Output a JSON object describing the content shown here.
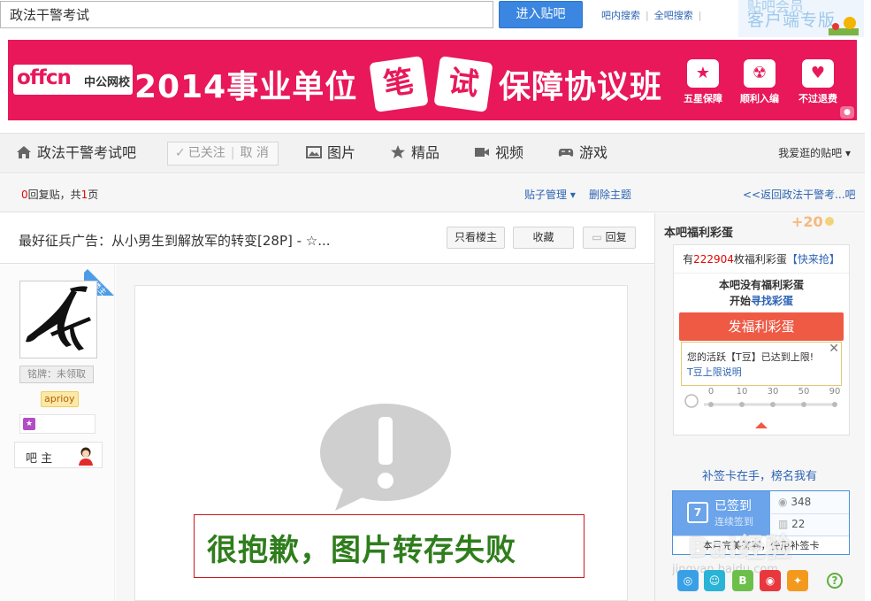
{
  "search": {
    "value": "政法干警考试",
    "enter_label": "进入贴吧",
    "in_bar_label": "吧内搜索",
    "all_bar_label": "全吧搜索",
    "sep": "|"
  },
  "client_banner": {
    "line1": "贴吧会员",
    "line2": "客户端专版"
  },
  "ad": {
    "logo_text": "offcn",
    "logo_sub": "中公网校",
    "headline_a": "2014事业单位",
    "tile1": "笔",
    "tile2": "试",
    "headline_b": "保障协议班",
    "badges": [
      {
        "label": "五星保障",
        "icon": "star-icon"
      },
      {
        "label": "顺利入编",
        "icon": "radiation-icon"
      },
      {
        "label": "不过退费",
        "icon": "heart-icon"
      }
    ]
  },
  "forum_nav": {
    "bar_name": "政法干警考试吧",
    "follow_label": "已关注",
    "unfollow_label": "取 消",
    "tabs": [
      {
        "label": "图片",
        "icon": "image-icon"
      },
      {
        "label": "精品",
        "icon": "star-icon"
      },
      {
        "label": "视频",
        "icon": "video-icon"
      },
      {
        "label": "游戏",
        "icon": "gamepad-icon"
      }
    ],
    "fav_bars": "我爱逛的贴吧"
  },
  "reply_bar": {
    "count": "0",
    "count_suffix": "回复贴，共",
    "pages": "1",
    "pages_suffix": "页",
    "admin_label": "贴子管理",
    "delete_label": "删除主题",
    "back_label": "<<返回政法干警考...吧"
  },
  "thread": {
    "title": "最好征兵广告：从小男生到解放军的转变[28P] - ☆...",
    "only_op_label": "只看楼主",
    "collect_label": "收藏",
    "reply_label": "回复"
  },
  "author": {
    "ribbon": "楼主",
    "medal": "铭牌：未领取",
    "username": "aprioy",
    "role": "吧 主"
  },
  "post": {
    "fail_text": "很抱歉，图片转存失败"
  },
  "sidebar": {
    "title": "本吧福利彩蛋",
    "plus": "+20",
    "egg_prefix": "有",
    "egg_count": "222904",
    "egg_suffix": "枚福利彩蛋",
    "egg_grab": "【快来抢】",
    "msg1": "本吧没有福利彩蛋",
    "msg2_prefix": "开始",
    "msg2_link": "寻找彩蛋",
    "egg_button": "发福利彩蛋",
    "scale": [
      "0",
      "10",
      "30",
      "50",
      "90"
    ],
    "tooltip_text": "您的活跃【T豆】已达到上限!",
    "tooltip_link": "T豆上限说明",
    "supp_text": "补签卡在手，榜名我有",
    "sign": {
      "done": "已签到",
      "cont": "连续签到",
      "cal_day": "7",
      "stat1": "348",
      "stat2": "22",
      "bottom": "本月完美签到，使用补签卡"
    },
    "watermark": "Bai经验",
    "watermark2": "jingyan.baidu.com"
  },
  "colors": {
    "accent": "#3a86e0",
    "ad_bg": "#e8185a",
    "link": "#2d64b3",
    "egg_red": "#ef5a45",
    "fail_green": "#2f7d1c"
  }
}
